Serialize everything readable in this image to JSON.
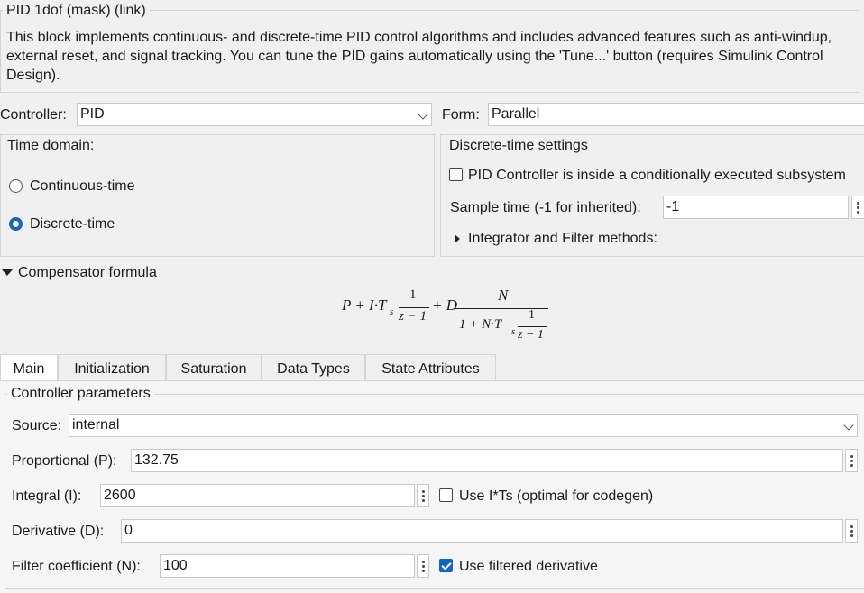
{
  "block": {
    "title": "PID 1dof (mask) (link)",
    "description": "This block implements continuous- and discrete-time PID control algorithms and includes advanced features such as anti-windup, external reset, and signal tracking. You can tune the PID gains automatically using the 'Tune...' button (requires Simulink Control Design)."
  },
  "controller": {
    "label": "Controller:",
    "value": "PID"
  },
  "form": {
    "label": "Form:",
    "value": "Parallel"
  },
  "time_domain": {
    "label": "Time domain:",
    "options": [
      {
        "label": "Continuous-time",
        "selected": false
      },
      {
        "label": "Discrete-time",
        "selected": true
      }
    ]
  },
  "discrete_settings": {
    "label": "Discrete-time settings",
    "conditional_label": "PID Controller is inside a conditionally executed subsystem",
    "conditional_checked": false,
    "sample_time_label": "Sample time (-1 for inherited):",
    "sample_time_value": "-1",
    "methods_label": "Integrator and Filter methods:"
  },
  "compensator": {
    "label": "Compensator formula",
    "formula": {
      "p": "P + I·T",
      "s1": "s",
      "one": "1",
      "den1": "z − 1",
      "plusd": "+ D",
      "n": "N",
      "den_left": "1 + N·T",
      "s2": "s",
      "one2": "1",
      "den2": "z − 1"
    }
  },
  "tabs": [
    {
      "label": "Main",
      "active": true
    },
    {
      "label": "Initialization",
      "active": false
    },
    {
      "label": "Saturation",
      "active": false
    },
    {
      "label": "Data Types",
      "active": false
    },
    {
      "label": "State Attributes",
      "active": false
    }
  ],
  "controller_params": {
    "label": "Controller parameters",
    "source": {
      "label": "Source:",
      "value": "internal"
    },
    "proportional": {
      "label": "Proportional (P):",
      "value": "132.75"
    },
    "integral": {
      "label": "Integral (I):",
      "value": "2600"
    },
    "use_its": {
      "label": "Use I*Ts (optimal for codegen)",
      "checked": false
    },
    "derivative": {
      "label": "Derivative (D):",
      "value": "0"
    },
    "filter": {
      "label": "Filter coefficient (N):",
      "value": "100"
    },
    "use_filtered": {
      "label": "Use filtered derivative",
      "checked": true
    }
  },
  "colors": {
    "accent": "#1565c0",
    "background": "#f0f0f0",
    "border": "#d4d4d4"
  }
}
